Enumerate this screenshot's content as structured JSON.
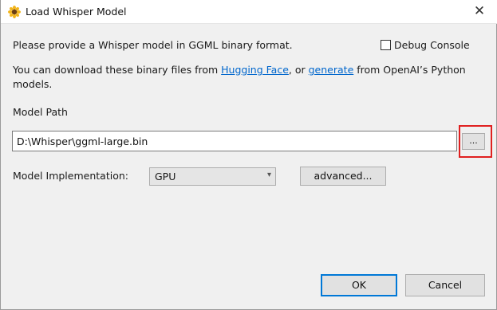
{
  "window": {
    "title": "Load Whisper Model",
    "close_glyph": "✕"
  },
  "content": {
    "intro": "Please provide a Whisper model in GGML binary format.",
    "download_prefix": "You can download these binary files from ",
    "link_hugging_face": "Hugging Face",
    "download_middle": ", or ",
    "link_generate": "generate",
    "download_suffix": " from OpenAI’s Python",
    "download_line2": "models.",
    "debug_console_label": "Debug Console",
    "debug_console_checked": false
  },
  "model_path": {
    "label": "Model Path",
    "value": "D:\\Whisper\\ggml-large.bin",
    "browse_label": "..."
  },
  "implementation": {
    "label": "Model Implementation:",
    "selected": "GPU",
    "advanced_label": "advanced..."
  },
  "footer": {
    "ok_label": "OK",
    "cancel_label": "Cancel"
  },
  "icons": {
    "app": "sunflower-icon",
    "close": "close-icon",
    "dropdown": "chevron-down-icon"
  },
  "colors": {
    "link": "#0066cc",
    "highlight": "#e02020",
    "default_button_border": "#0078d7"
  }
}
